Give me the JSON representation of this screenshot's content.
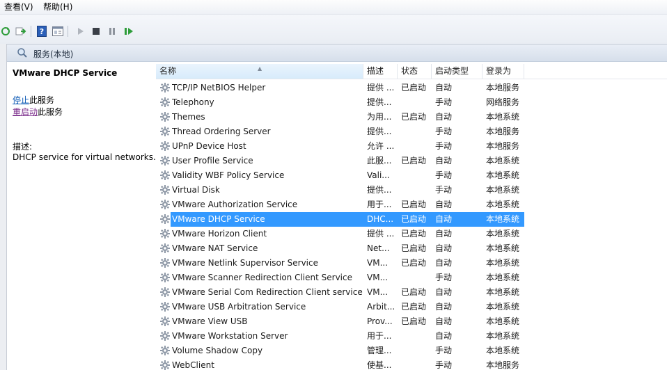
{
  "menu": {
    "view": "查看(V)",
    "help": "帮助(H)"
  },
  "toolbar_icons": [
    "refresh-icon",
    "export-icon",
    "help-icon",
    "properties-icon",
    "start-icon",
    "stop-icon",
    "pause-icon",
    "resume-icon"
  ],
  "header": {
    "title": "服务(本地)"
  },
  "detail": {
    "title": "VMware DHCP Service",
    "stop_link": "停止",
    "stop_suffix": "此服务",
    "restart_link": "重启动",
    "restart_suffix": "此服务",
    "desc_label": "描述:",
    "desc_text": "DHCP service for virtual networks."
  },
  "table": {
    "columns": [
      "名称",
      "描述",
      "状态",
      "启动类型",
      "登录为"
    ],
    "selected_index": 9,
    "rows": [
      {
        "name": "TCP/IP NetBIOS Helper",
        "desc": "提供 ...",
        "status": "已启动",
        "start": "自动",
        "logon": "本地服务"
      },
      {
        "name": "Telephony",
        "desc": "提供...",
        "status": "",
        "start": "手动",
        "logon": "网络服务"
      },
      {
        "name": "Themes",
        "desc": "为用...",
        "status": "已启动",
        "start": "自动",
        "logon": "本地系统"
      },
      {
        "name": "Thread Ordering Server",
        "desc": "提供...",
        "status": "",
        "start": "手动",
        "logon": "本地服务"
      },
      {
        "name": "UPnP Device Host",
        "desc": "允许 ...",
        "status": "",
        "start": "手动",
        "logon": "本地服务"
      },
      {
        "name": "User Profile Service",
        "desc": "此服...",
        "status": "已启动",
        "start": "自动",
        "logon": "本地系统"
      },
      {
        "name": "Validity WBF Policy Service",
        "desc": "Vali...",
        "status": "",
        "start": "手动",
        "logon": "本地系统"
      },
      {
        "name": "Virtual Disk",
        "desc": "提供...",
        "status": "",
        "start": "手动",
        "logon": "本地系统"
      },
      {
        "name": "VMware Authorization Service",
        "desc": "用于...",
        "status": "已启动",
        "start": "自动",
        "logon": "本地系统"
      },
      {
        "name": "VMware DHCP Service",
        "desc": "DHC...",
        "status": "已启动",
        "start": "自动",
        "logon": "本地系统"
      },
      {
        "name": "VMware Horizon Client",
        "desc": "提供 ...",
        "status": "已启动",
        "start": "自动",
        "logon": "本地系统"
      },
      {
        "name": "VMware NAT Service",
        "desc": "Net...",
        "status": "已启动",
        "start": "自动",
        "logon": "本地系统"
      },
      {
        "name": "VMware Netlink Supervisor Service",
        "desc": "VM...",
        "status": "已启动",
        "start": "自动",
        "logon": "本地系统"
      },
      {
        "name": "VMware Scanner Redirection Client Service",
        "desc": "VM...",
        "status": "",
        "start": "手动",
        "logon": "本地系统"
      },
      {
        "name": "VMware Serial Com Redirection Client service",
        "desc": "VM...",
        "status": "已启动",
        "start": "自动",
        "logon": "本地系统"
      },
      {
        "name": "VMware USB Arbitration Service",
        "desc": "Arbit...",
        "status": "已启动",
        "start": "自动",
        "logon": "本地系统"
      },
      {
        "name": "VMware View USB",
        "desc": "Prov...",
        "status": "已启动",
        "start": "自动",
        "logon": "本地系统"
      },
      {
        "name": "VMware Workstation Server",
        "desc": "用于...",
        "status": "",
        "start": "自动",
        "logon": "本地系统"
      },
      {
        "name": "Volume Shadow Copy",
        "desc": "管理...",
        "status": "",
        "start": "手动",
        "logon": "本地系统"
      },
      {
        "name": "WebClient",
        "desc": "使基...",
        "status": "",
        "start": "手动",
        "logon": "本地服务"
      }
    ]
  },
  "colors": {
    "selection": "#3399ff",
    "link": "#0a58b4",
    "visited_link": "#7a2a8a"
  }
}
